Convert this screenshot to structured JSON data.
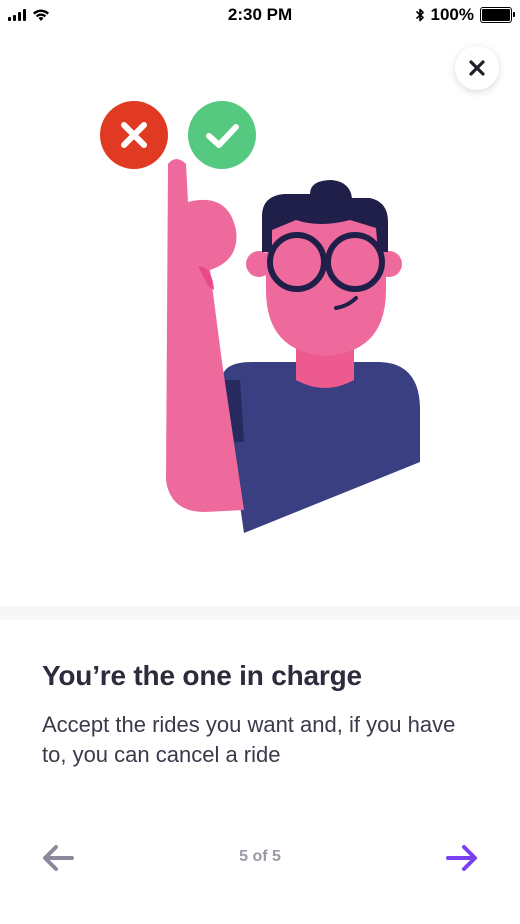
{
  "status_bar": {
    "time": "2:30 PM",
    "battery": "100%",
    "icons": [
      "signal-icon",
      "wifi-icon",
      "bluetooth-icon",
      "battery-icon"
    ]
  },
  "close_icon": "close-icon",
  "illustration": {
    "icons": [
      "reject-icon",
      "accept-icon"
    ],
    "colors": {
      "reject": "#e03a22",
      "accept": "#54c97f",
      "skin": "#ef6a9c",
      "shirt": "#3a3f82",
      "hair": "#1f1f4a"
    }
  },
  "content": {
    "title": "You’re the one in charge",
    "description": "Accept the rides you want and, if you have to, you can cancel a ride"
  },
  "navigation": {
    "page_indicator": "5 of 5",
    "prev_icon": "arrow-left-icon",
    "next_icon": "arrow-right-icon",
    "colors": {
      "prev": "#8b8a9d",
      "next": "#7b3ff2"
    }
  }
}
